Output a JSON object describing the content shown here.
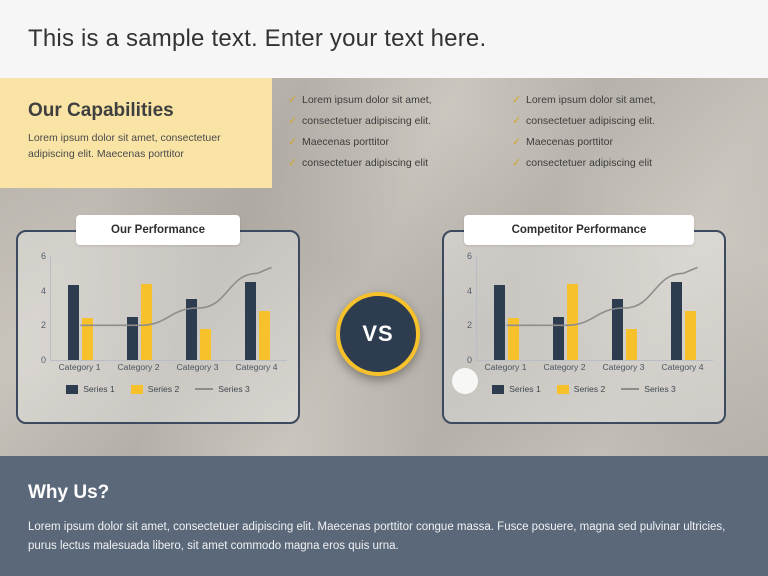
{
  "header": {
    "title": "This is a sample text. Enter your text here."
  },
  "capabilities": {
    "title": "Our Capabilities",
    "subtitle": "Lorem ipsum dolor sit amet, consectetuer adipiscing elit. Maecenas porttitor",
    "bullet_icon": "check-icon",
    "column1": [
      "Lorem ipsum dolor sit amet,",
      "consectetuer adipiscing elit.",
      "Maecenas porttitor",
      "consectetuer adipiscing elit"
    ],
    "column2": [
      "Lorem ipsum dolor sit amet,",
      "consectetuer adipiscing elit.",
      "Maecenas porttitor",
      "consectetuer adipiscing elit"
    ]
  },
  "vs_badge": {
    "label": "VS"
  },
  "panels": [
    {
      "label": "Our Performance"
    },
    {
      "label": "Competitor Performance"
    }
  ],
  "colors": {
    "series1": "#2e3c4f",
    "series2": "#f6c12a",
    "series3": "#8d8d8d",
    "band": "#f9e4a6",
    "footer": "#5b687a",
    "panel_border": "#3b4a5e"
  },
  "chart_data": [
    {
      "type": "bar",
      "title": "Our Performance",
      "categories": [
        "Category 1",
        "Category 2",
        "Category 3",
        "Category 4"
      ],
      "series": [
        {
          "name": "Series 1",
          "type": "bar",
          "values": [
            4.3,
            2.5,
            3.5,
            4.5
          ]
        },
        {
          "name": "Series 2",
          "type": "bar",
          "values": [
            2.4,
            4.4,
            1.8,
            2.8
          ]
        },
        {
          "name": "Series 3",
          "type": "line",
          "values": [
            2.0,
            2.0,
            3.0,
            5.0
          ]
        }
      ],
      "xlabel": "",
      "ylabel": "",
      "yticks": [
        0,
        2,
        4,
        6
      ],
      "ylim": [
        0,
        6
      ],
      "grid": false,
      "legend": "bottom"
    },
    {
      "type": "bar",
      "title": "Competitor Performance",
      "categories": [
        "Category 1",
        "Category 2",
        "Category 3",
        "Category 4"
      ],
      "series": [
        {
          "name": "Series 1",
          "type": "bar",
          "values": [
            4.3,
            2.5,
            3.5,
            4.5
          ]
        },
        {
          "name": "Series 2",
          "type": "bar",
          "values": [
            2.4,
            4.4,
            1.8,
            2.8
          ]
        },
        {
          "name": "Series 3",
          "type": "line",
          "values": [
            2.0,
            2.0,
            3.0,
            5.0
          ]
        }
      ],
      "xlabel": "",
      "ylabel": "",
      "yticks": [
        0,
        2,
        4,
        6
      ],
      "ylim": [
        0,
        6
      ],
      "grid": false,
      "legend": "bottom"
    }
  ],
  "footer": {
    "title": "Why Us?",
    "body": "Lorem ipsum dolor sit amet, consectetuer adipiscing elit. Maecenas porttitor congue massa. Fusce posuere, magna sed pulvinar ultricies, purus lectus malesuada libero, sit amet commodo magna eros quis urna."
  }
}
